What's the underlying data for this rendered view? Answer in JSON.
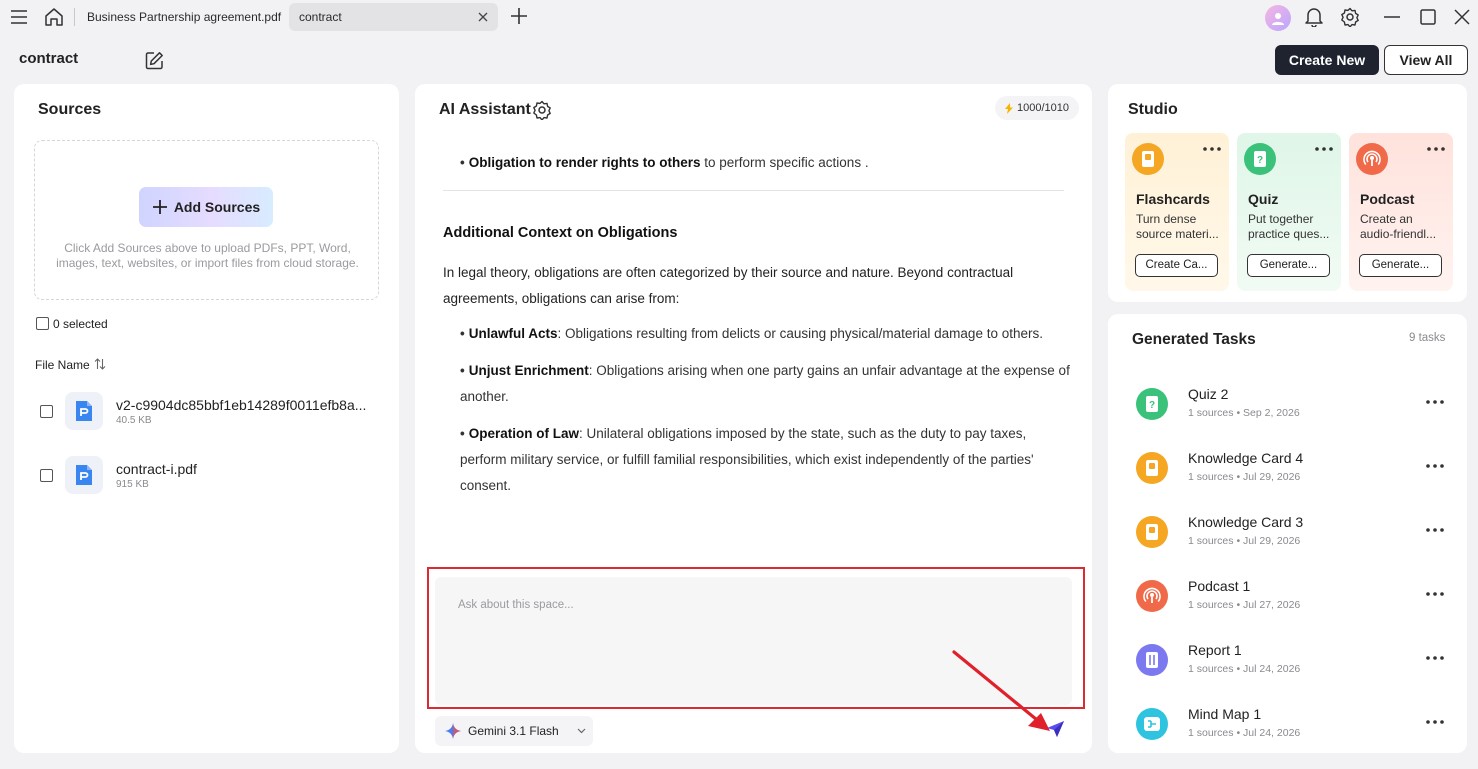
{
  "titlebar": {
    "tabs": [
      {
        "label": "Business Partnership agreement.pdf",
        "active": false
      },
      {
        "label": "contract",
        "active": true
      }
    ]
  },
  "header": {
    "space_title": "contract",
    "create_new_label": "Create New",
    "view_all_label": "View All"
  },
  "sources": {
    "title": "Sources",
    "add_sources_label": "Add Sources",
    "hint": "Click Add Sources above to upload PDFs, PPT, Word, images, text, websites, or import files from cloud storage.",
    "selected_label": "0 selected",
    "file_name_header": "File Name",
    "files": [
      {
        "name": "v2-c9904dc85bbf1eb14289f0011efb8a...",
        "size": "40.5 KB"
      },
      {
        "name": "contract-i.pdf",
        "size": "915 KB"
      }
    ]
  },
  "assistant": {
    "title": "AI Assistant",
    "tokens": "1000/1010",
    "bullet0_bold": "Obligation to render rights to others",
    "bullet0_text": " to perform specific actions .",
    "section_heading": "Additional Context on Obligations",
    "paragraph": "In legal theory, obligations are often categorized by their source and nature. Beyond contractual agreements, obligations can arise from:",
    "bullets": [
      {
        "bold": "Unlawful Acts",
        "text": ": Obligations resulting from delicts or causing physical/material damage to others."
      },
      {
        "bold": "Unjust Enrichment",
        "text": ": Obligations arising when one party gains an unfair advantage at the expense of another."
      },
      {
        "bold": "Operation of Law",
        "text": ": Unilateral obligations imposed by the state, such as the duty to pay taxes, perform military service, or fulfill familial responsibilities, which exist independently of the parties' consent."
      }
    ],
    "input_placeholder": "Ask about this space...",
    "model_label": "Gemini 3.1 Flash"
  },
  "studio": {
    "title": "Studio",
    "cards": [
      {
        "name": "Flashcards",
        "desc": "Turn dense source materi...",
        "button": "Create Ca...",
        "color": "#f5a623"
      },
      {
        "name": "Quiz",
        "desc": "Put together practice ques...",
        "button": "Generate...",
        "color": "#3ac27a"
      },
      {
        "name": "Podcast",
        "desc": "Create an audio-friendl...",
        "button": "Generate...",
        "color": "#f06a4a"
      }
    ]
  },
  "tasks": {
    "title": "Generated Tasks",
    "count": "9 tasks",
    "items": [
      {
        "name": "Quiz 2",
        "meta": "1 sources • Sep 2, 2026",
        "icon": "quiz-icon"
      },
      {
        "name": "Knowledge Card 4",
        "meta": "1 sources • Jul 29, 2026",
        "icon": "flashcard-icon"
      },
      {
        "name": "Knowledge Card 3",
        "meta": "1 sources • Jul 29, 2026",
        "icon": "flashcard-icon"
      },
      {
        "name": "Podcast 1",
        "meta": "1 sources • Jul 27, 2026",
        "icon": "podcast-icon"
      },
      {
        "name": "Report 1",
        "meta": "1 sources • Jul 24, 2026",
        "icon": "report-icon"
      },
      {
        "name": "Mind Map 1",
        "meta": "1 sources • Jul 24, 2026",
        "icon": "mindmap-icon"
      }
    ]
  },
  "colors": {
    "annotation_red": "#dc2a30",
    "primary_dark": "#1f2330",
    "send_purple": "#5b4cf0"
  }
}
